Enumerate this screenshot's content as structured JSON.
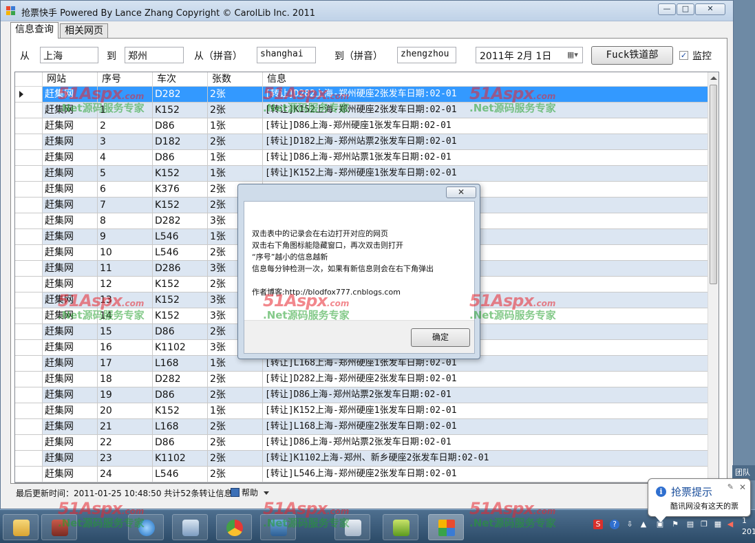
{
  "window": {
    "title": "抢票快手 Powered By Lance Zhang Copyright © CarolLib Inc. 2011",
    "min": "—",
    "max": "□",
    "close": "✕"
  },
  "tabs": [
    {
      "label": "信息查询"
    },
    {
      "label": "相关网页"
    }
  ],
  "search": {
    "from_label": "从",
    "from_value": "上海",
    "to_label": "到",
    "to_value": "郑州",
    "from_pinyin_label": "从（拼音）",
    "from_pinyin_value": "shanghai",
    "to_pinyin_label": "到（拼音）",
    "to_pinyin_value": "zhengzhou",
    "date_value": "2011年 2月 1日",
    "go_button": "Fuck铁道部",
    "monitor_label": "监控",
    "monitor_checked": "✓"
  },
  "grid": {
    "columns": [
      "网站",
      "序号",
      "车次",
      "张数",
      "信息"
    ],
    "rows": [
      {
        "site": "赶集网",
        "seq": "",
        "train": "D282",
        "count": "2张",
        "info": "[转让]D282上海-郑州硬座2张发车日期:02-01"
      },
      {
        "site": "赶集网",
        "seq": "1",
        "train": "K152",
        "count": "2张",
        "info": "[转让]K152上海-郑州硬座2张发车日期:02-01"
      },
      {
        "site": "赶集网",
        "seq": "2",
        "train": "D86",
        "count": "1张",
        "info": "[转让]D86上海-郑州硬座1张发车日期:02-01"
      },
      {
        "site": "赶集网",
        "seq": "3",
        "train": "D182",
        "count": "2张",
        "info": "[转让]D182上海-郑州站票2张发车日期:02-01"
      },
      {
        "site": "赶集网",
        "seq": "4",
        "train": "D86",
        "count": "1张",
        "info": "[转让]D86上海-郑州站票1张发车日期:02-01"
      },
      {
        "site": "赶集网",
        "seq": "5",
        "train": "K152",
        "count": "1张",
        "info": "[转让]K152上海-郑州硬座1张发车日期:02-01"
      },
      {
        "site": "赶集网",
        "seq": "6",
        "train": "K376",
        "count": "2张",
        "info": ""
      },
      {
        "site": "赶集网",
        "seq": "7",
        "train": "K152",
        "count": "2张",
        "info": ""
      },
      {
        "site": "赶集网",
        "seq": "8",
        "train": "D282",
        "count": "3张",
        "info": ""
      },
      {
        "site": "赶集网",
        "seq": "9",
        "train": "L546",
        "count": "1张",
        "info": ""
      },
      {
        "site": "赶集网",
        "seq": "10",
        "train": "L546",
        "count": "2张",
        "info": ""
      },
      {
        "site": "赶集网",
        "seq": "11",
        "train": "D286",
        "count": "3张",
        "info": ""
      },
      {
        "site": "赶集网",
        "seq": "12",
        "train": "K152",
        "count": "2张",
        "info": ""
      },
      {
        "site": "赶集网",
        "seq": "13",
        "train": "K152",
        "count": "3张",
        "info": ""
      },
      {
        "site": "赶集网",
        "seq": "14",
        "train": "K152",
        "count": "3张",
        "info": ""
      },
      {
        "site": "赶集网",
        "seq": "15",
        "train": "D86",
        "count": "2张",
        "info": ""
      },
      {
        "site": "赶集网",
        "seq": "16",
        "train": "K1102",
        "count": "3张",
        "info": ""
      },
      {
        "site": "赶集网",
        "seq": "17",
        "train": "L168",
        "count": "1张",
        "info": "[转让]L168上海-郑州硬座1张发车日期:02-01"
      },
      {
        "site": "赶集网",
        "seq": "18",
        "train": "D282",
        "count": "2张",
        "info": "[转让]D282上海-郑州硬座2张发车日期:02-01"
      },
      {
        "site": "赶集网",
        "seq": "19",
        "train": "D86",
        "count": "2张",
        "info": "[转让]D86上海-郑州站票2张发车日期:02-01"
      },
      {
        "site": "赶集网",
        "seq": "20",
        "train": "K152",
        "count": "1张",
        "info": "[转让]K152上海-郑州硬座1张发车日期:02-01"
      },
      {
        "site": "赶集网",
        "seq": "21",
        "train": "L168",
        "count": "2张",
        "info": "[转让]L168上海-郑州硬座2张发车日期:02-01"
      },
      {
        "site": "赶集网",
        "seq": "22",
        "train": "D86",
        "count": "2张",
        "info": "[转让]D86上海-郑州站票2张发车日期:02-01"
      },
      {
        "site": "赶集网",
        "seq": "23",
        "train": "K1102",
        "count": "2张",
        "info": "[转让]K1102上海-郑州、新乡硬座2张发车日期:02-01"
      },
      {
        "site": "赶集网",
        "seq": "24",
        "train": "L546",
        "count": "2张",
        "info": "[转让]L546上海-郑州硬座2张发车日期:02-01"
      }
    ]
  },
  "status": {
    "text": "最后更新时间：2011-01-25 10:48:50 共计52条转让信息",
    "help": "帮助"
  },
  "dialog": {
    "close": "✕",
    "lines": [
      "双击表中的记录会在右边打开对应的网页",
      "双击右下角图标能隐藏窗口，再次双击则打开",
      "“序号”越小的信息越新",
      "信息每分钟检测一次，如果有新信息则会在右下角弹出",
      "作者博客:http://blodfox777.cnblogs.com"
    ],
    "ok": "确定"
  },
  "balloon": {
    "title": "抢票提示",
    "text": "酷讯网没有这天的票",
    "close": "✕",
    "settings": "✎"
  },
  "watermark": {
    "logo": "51Aspx",
    "domain": ".com",
    "sub": ".Net源码服务专家"
  },
  "side_tab": "团队",
  "clock": "1\n201"
}
